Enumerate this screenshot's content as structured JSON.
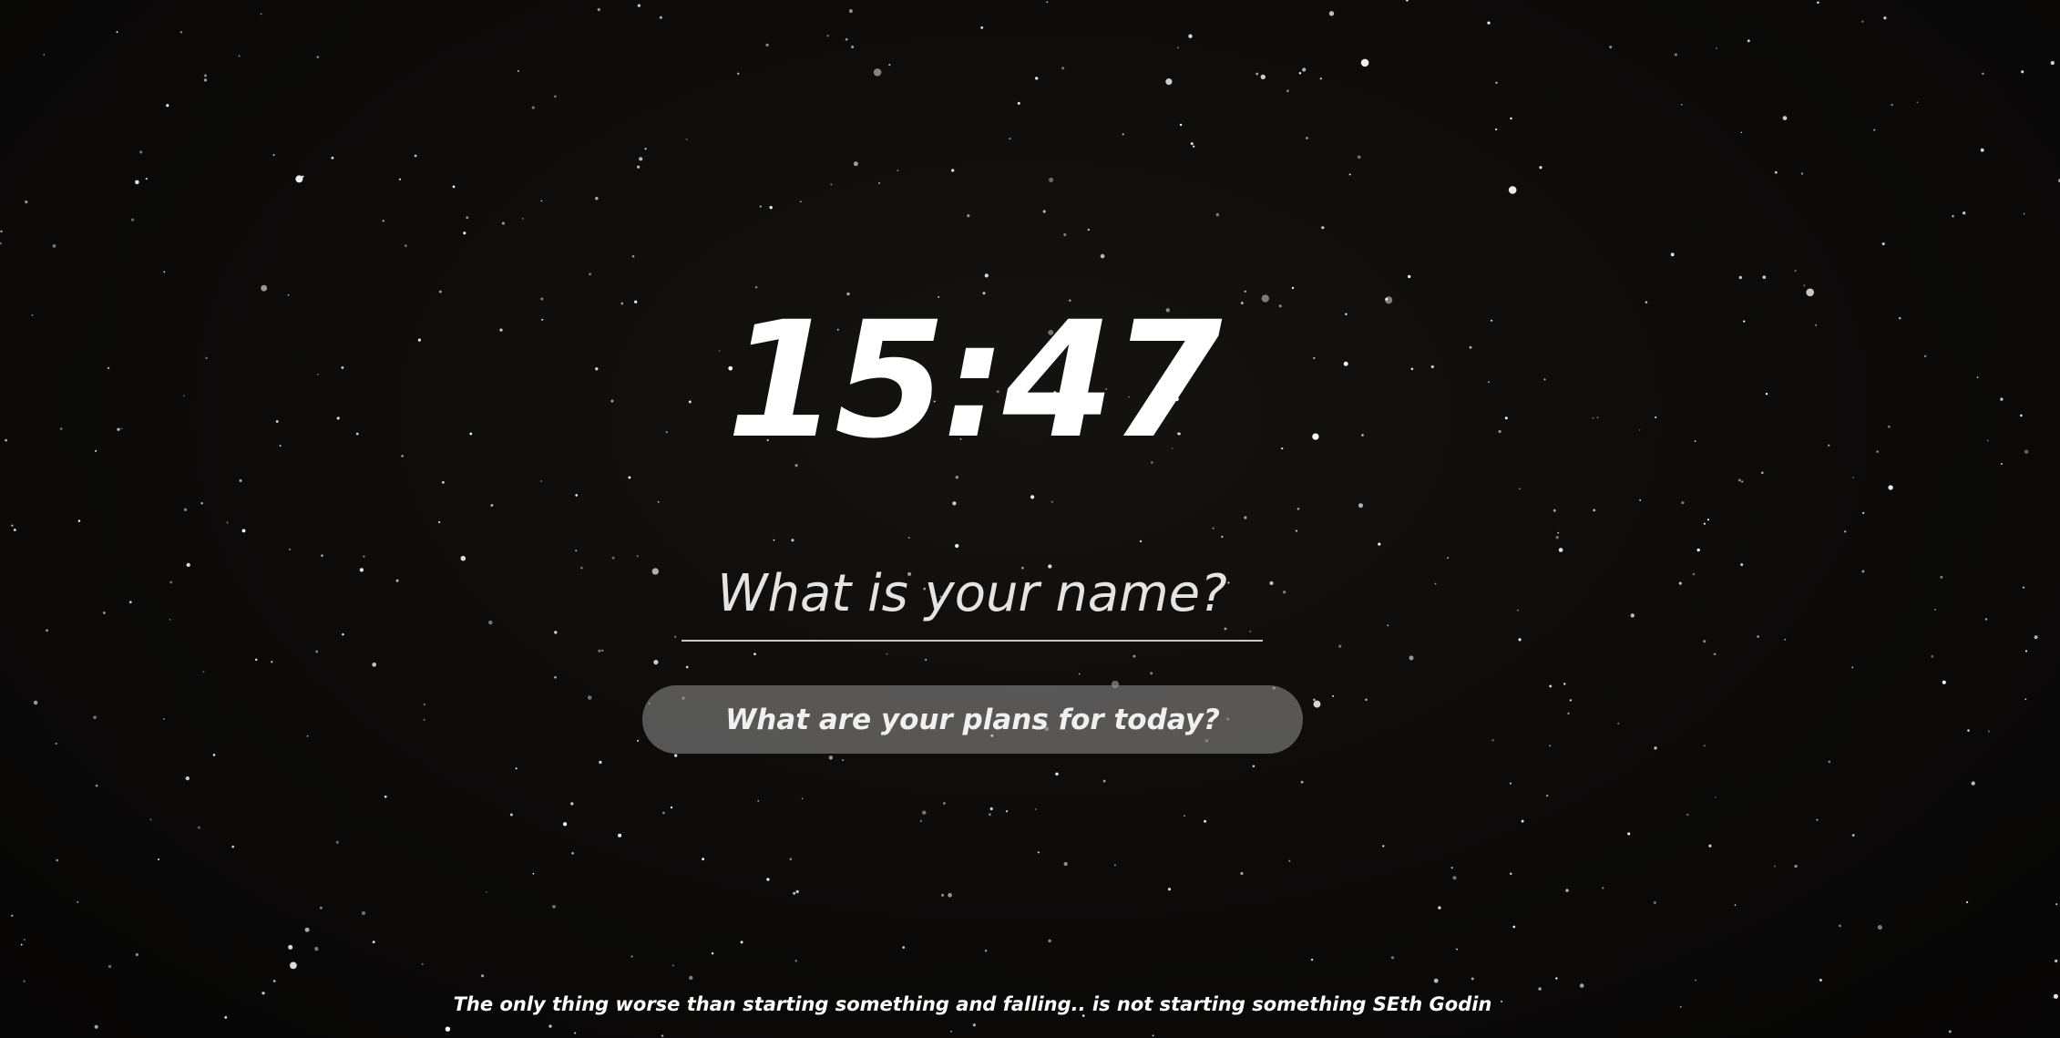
{
  "clock": {
    "time": "15:47"
  },
  "name_field": {
    "placeholder": "What is your name?",
    "value": ""
  },
  "focus_field": {
    "placeholder": "What are your plans for today?",
    "value": ""
  },
  "quote": {
    "text": "The only thing worse than starting something and falling.. is not starting something SEth Godin"
  },
  "background": {
    "kind": "starry-night-sky",
    "base_color": "#0a0908",
    "star_color": "#ffffff"
  }
}
